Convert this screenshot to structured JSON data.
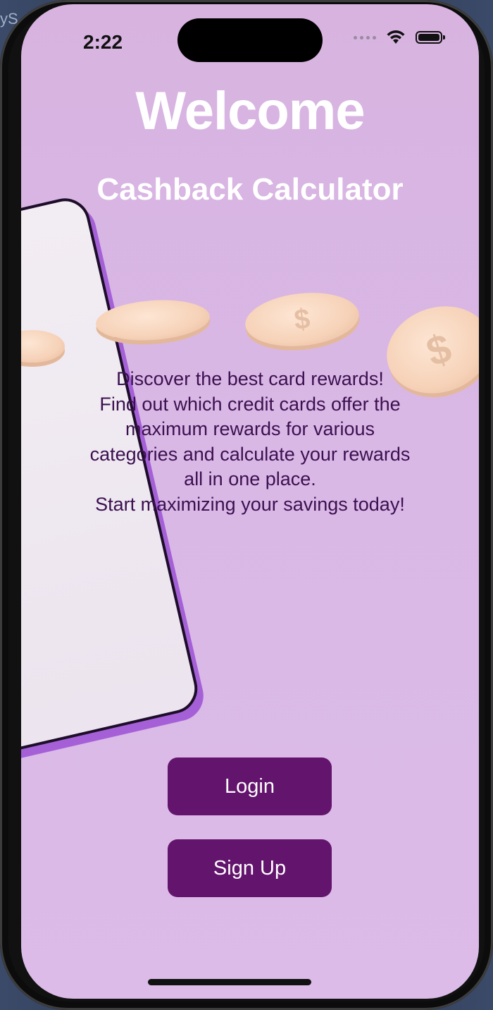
{
  "background": {
    "peek_text": "yS"
  },
  "status_bar": {
    "time": "2:22",
    "icons": [
      "signal-icon",
      "wifi-icon",
      "battery-icon"
    ]
  },
  "welcome": {
    "title": "Welcome",
    "subtitle": "Cashback Calculator",
    "description": "Discover the best card rewards!\nFind out which credit cards offer the\nmaximum rewards for various\ncategories and calculate your rewards\nall in one place.\nStart maximizing your savings today!"
  },
  "actions": {
    "login_label": "Login",
    "signup_label": "Sign Up"
  },
  "coin_symbol": "$",
  "colors": {
    "background": "#d9b8e6",
    "button": "#63146c",
    "button_text": "#ffffff",
    "title_text": "#ffffff",
    "body_text": "#3b1050",
    "card_edge": "#a560d8",
    "coin": "#f6d2b8"
  }
}
